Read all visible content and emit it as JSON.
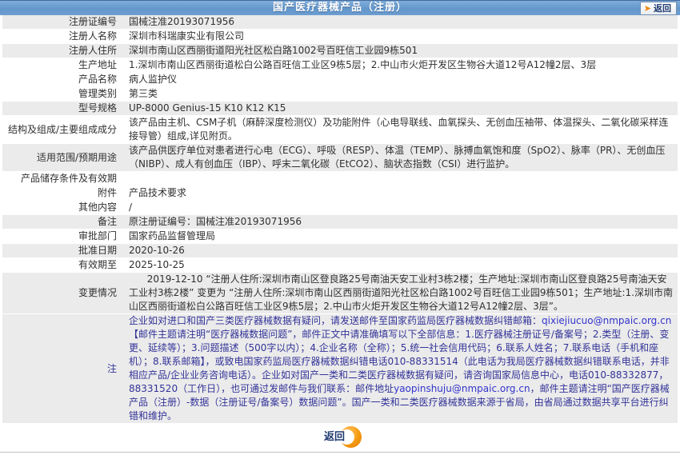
{
  "header": {
    "title": "国产医疗器械产品（注册）",
    "back_label": "返回",
    "back_icon": "orange-right-arrow"
  },
  "footer": {
    "back_label": "返回",
    "back_icon": "orange-crescent-circle"
  },
  "colors": {
    "header_blue": "#6699cc",
    "row_shade_gray": "#ebebeb",
    "accent_orange": "#f59a12",
    "note_text_blue": "#333399",
    "link_blue": "#3333cc"
  },
  "table": {
    "rows": [
      {
        "label": "注册证编号",
        "value": "国械注准20193071956",
        "shade": true
      },
      {
        "label": "注册人名称",
        "value": "深圳市科瑞康实业有限公司",
        "shade": false
      },
      {
        "label": "注册人住所",
        "value": "深圳市南山区西丽街道阳光社区松白路1002号百旺信工业园9栋501",
        "shade": true
      },
      {
        "label": "生产地址",
        "value": "1.深圳市南山区西丽街道松白公路百旺信工业区9栋5层；2.中山市火炬开发区生物谷大道12号A12幢2层、3层",
        "shade": false
      },
      {
        "label": "产品名称",
        "value": "病人监护仪",
        "shade": false
      },
      {
        "label": "管理类别",
        "value": "第三类",
        "shade": false
      },
      {
        "label": "型号规格",
        "value": "UP-8000 Genius-15 K10 K12 K15",
        "shade": true
      },
      {
        "label": "结构及组成/主要组成成分",
        "value": "该产品由主机、CSM子机（麻醉深度检测仪）及功能附件（心电导联线、血氧探头、无创血压袖带、体温探头、二氧化碳采样连接导管）组成,详见附页。",
        "shade": false
      },
      {
        "label": "适用范围/预期用途",
        "value": "该产品供医疗单位对患者进行心电（ECG）、呼吸（RESP）、体温（TEMP）、脉搏血氧饱和度（SpO2）、脉率（PR）、无创血压（NIBP）、成人有创血压（IBP）、呼末二氧化碳（EtCO2）、脑状态指数（CSI）进行监护。",
        "shade": true
      },
      {
        "label": "产品储存条件及有效期",
        "value": "",
        "shade": false
      },
      {
        "label": "附件",
        "value": "产品技术要求",
        "shade": false
      },
      {
        "label": "其他内容",
        "value": "/",
        "shade": false
      },
      {
        "label": "备注",
        "value": "原注册证编号：国械注准20193071956",
        "shade": true
      },
      {
        "label": "审批部门",
        "value": "国家药品监督管理局",
        "shade": false
      },
      {
        "label": "批准日期",
        "value": "2020-10-26",
        "shade": true
      },
      {
        "label": "有效期至",
        "value": "2025-10-25",
        "shade": false
      },
      {
        "label": "变更情况",
        "value": "2019-12-10 “注册人住所:深圳市南山区登良路25号南油天安工业村3栋2楼；生产地址:深圳市南山区登良路25号南油天安工业村3栋2楼” 变更为 “注册人住所:深圳市南山区西丽街道阳光社区松白路1002号百旺信工业园9栋501；生产地址:1.深圳市南山区西丽街道松白公路百旺信工业区9栋5层；2.中山市火炬开发区生物谷大道12号A12幢2层、3层”。",
        "shade": true,
        "indent": true
      },
      {
        "label": "注",
        "shade": true,
        "note": true,
        "segments": [
          {
            "text": "企业如对进口和国产三类医疗器械数据有疑问，请发送邮件至国家药监局医疗器械数据纠错邮箱："
          },
          {
            "text": "qixiejiucuo@nmpaic.org.cn",
            "link": true
          },
          {
            "text": "【邮件主题请注明“医疗器械数据问题”，邮件正文中请准确填写以下全部信息：1.医疗器械注册证号/备案号；2.类型（注册、变更、延续等）；3.问题描述（500字以内）；4.企业名称（全称）；5.统一社会信用代码；6.联系人姓名；7.联系电话（手机和座机）；8.联系邮箱】，或致电国家药监局医疗器械数据纠错电话010-88331514（此电话为我局医疗器械数据纠错联系电话，并非相应产品/企业业务咨询电话）。企业如对国产一类和二类医疗器械数据有疑问，请咨询国家局信息中心，电话010-88332877，88331520（工作日），也可通过发邮件与我们联系：邮件地址"
          },
          {
            "text": "yaopinshuju@nmpaic.org.cn",
            "link": true
          },
          {
            "text": "，邮件主题请注明“国产医疗器械产品（注册）-数据（注册证号/备案号）数据问题”。国产一类和二类医疗器械数据来源于省局，由省局通过数据共享平台进行纠错和维护。"
          }
        ]
      }
    ]
  }
}
